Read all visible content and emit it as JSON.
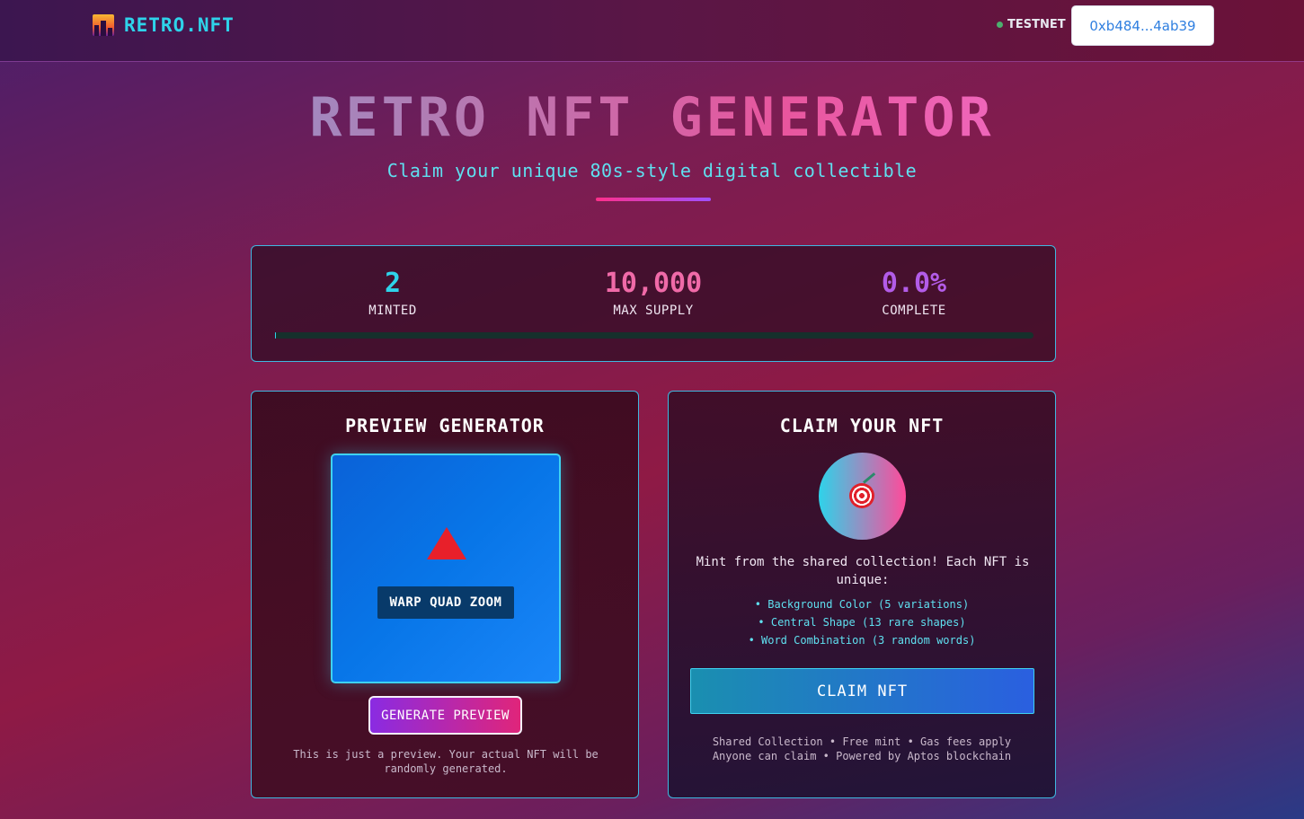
{
  "header": {
    "logo_text": "RETRO.NFT",
    "network_label": "TESTNET",
    "wallet_address": "0xb484...4ab39",
    "logo_icon": "cityscape-icon"
  },
  "hero": {
    "title": "RETRO NFT GENERATOR",
    "subtitle": "Claim your unique 80s-style digital collectible"
  },
  "stats": {
    "minted_value": "2",
    "minted_label": "MINTED",
    "supply_value": "10,000",
    "supply_label": "MAX SUPPLY",
    "complete_value": "0.0%",
    "complete_label": "COMPLETE",
    "progress_fraction": 0.0002
  },
  "preview": {
    "title": "PREVIEW GENERATOR",
    "shape_icon": "red-triangle-icon",
    "words": "WARP QUAD ZOOM",
    "button_label": "GENERATE PREVIEW",
    "note": "This is just a preview. Your actual NFT will be randomly generated."
  },
  "claim": {
    "title": "CLAIM YOUR NFT",
    "icon": "target-icon",
    "description": "Mint from the shared collection! Each NFT is unique:",
    "features": [
      "• Background Color (5 variations)",
      "• Central Shape (13 rare shapes)",
      "• Word Combination (3 random words)"
    ],
    "button_label": "CLAIM NFT",
    "footer_line1": "Shared Collection • Free mint • Gas fees apply",
    "footer_line2": "Anyone can claim • Powered by Aptos blockchain"
  },
  "colors": {
    "accent_cyan": "#2ed3ea",
    "accent_pink": "#e8569e",
    "accent_purple": "#b35ce8",
    "border": "#3fb8e0"
  }
}
